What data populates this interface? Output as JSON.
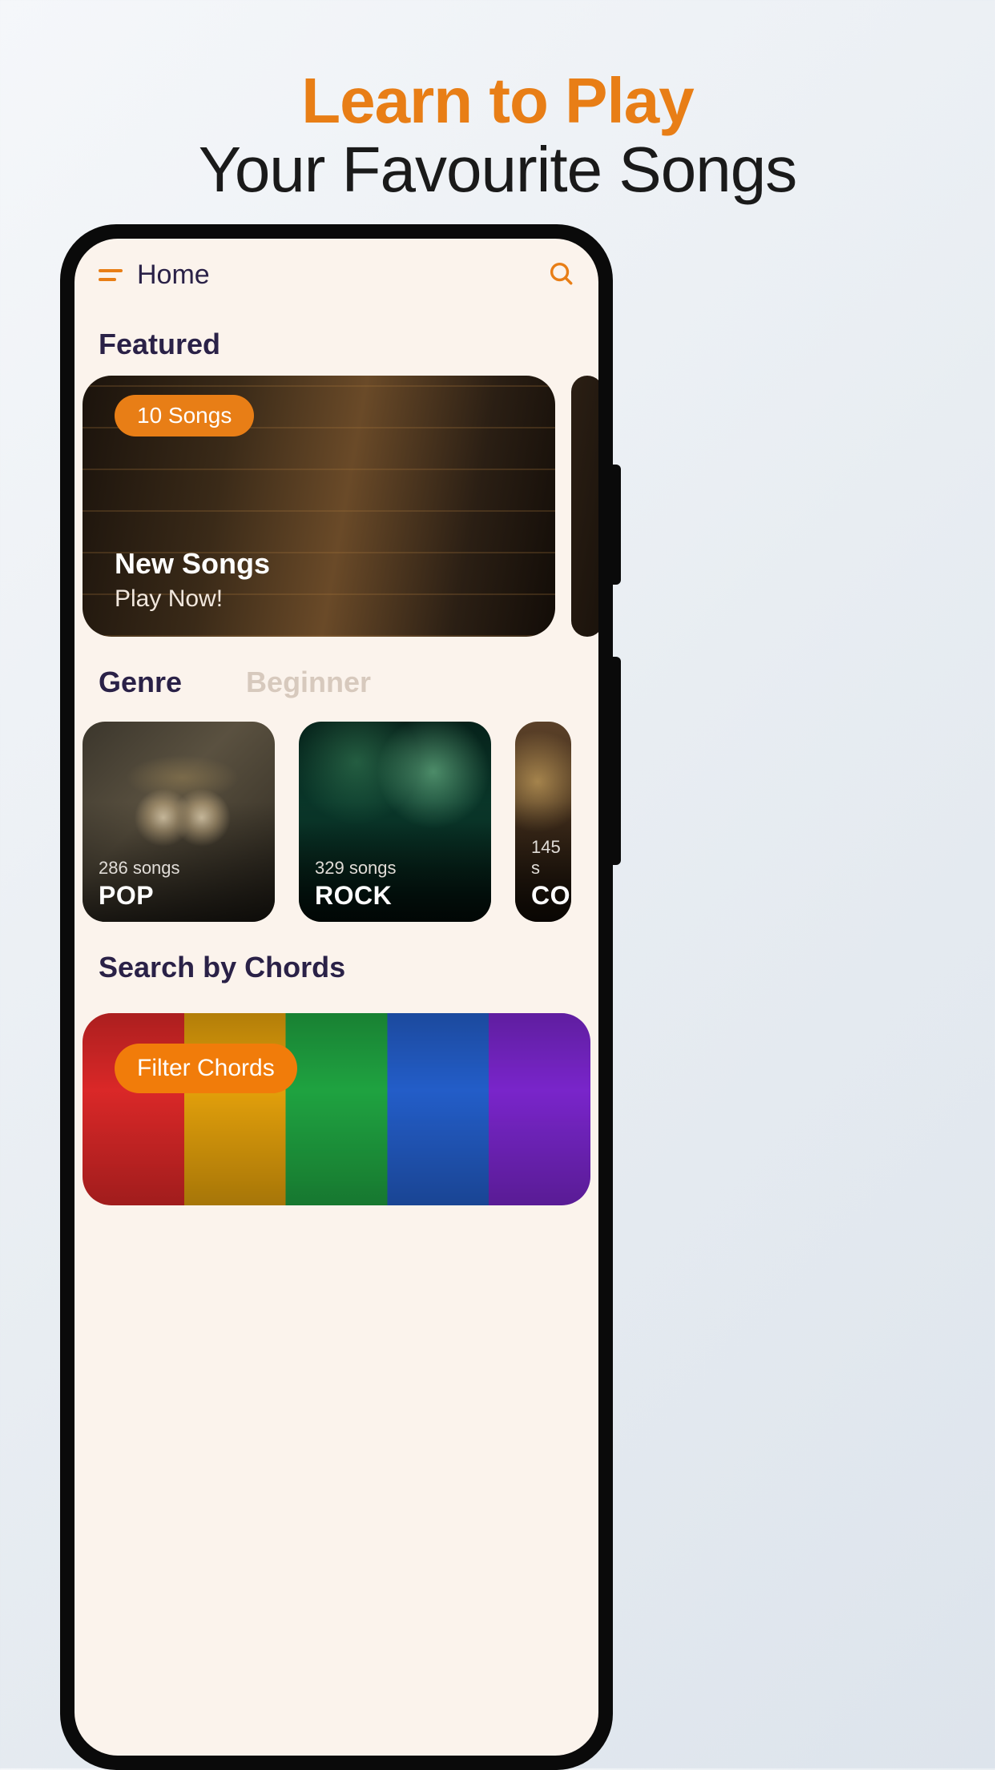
{
  "promo": {
    "line1": "Learn to Play",
    "line2": "Your Favourite Songs"
  },
  "header": {
    "title": "Home"
  },
  "featured": {
    "section_title": "Featured",
    "card": {
      "badge": "10 Songs",
      "title": "New Songs",
      "subtitle": "Play Now!"
    }
  },
  "tabs": {
    "genre": "Genre",
    "beginner": "Beginner"
  },
  "genres": [
    {
      "count": "286 songs",
      "name": "POP"
    },
    {
      "count": "329 songs",
      "name": "ROCK"
    },
    {
      "count": "145 s",
      "name": "CO"
    }
  ],
  "chords": {
    "section_title": "Search by Chords",
    "filter_label": "Filter Chords"
  }
}
